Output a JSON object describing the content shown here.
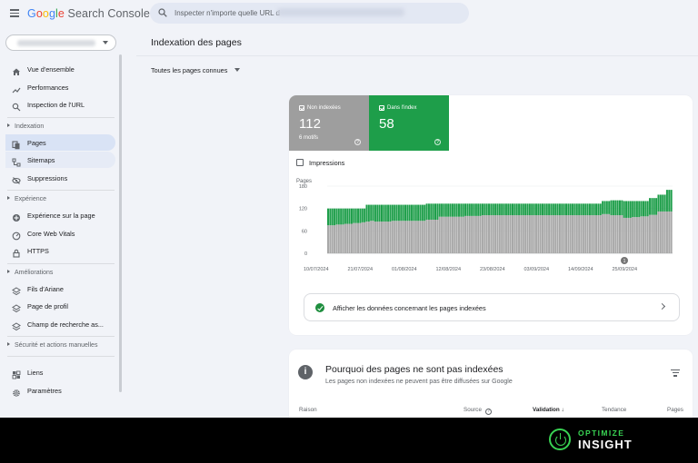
{
  "app": {
    "logo_google": [
      "G",
      "o",
      "o",
      "g",
      "l",
      "e"
    ],
    "logo_product": "Search Console"
  },
  "search": {
    "placeholder": "Inspecter n'importe quelle URL d"
  },
  "sidebar": {
    "items": [
      {
        "label": "Vue d'ensemble",
        "icon": "home-icon"
      },
      {
        "label": "Performances",
        "icon": "trending-up-icon"
      },
      {
        "label": "Inspection de l'URL",
        "icon": "search-icon"
      }
    ],
    "sections": [
      {
        "label": "Indexation",
        "items": [
          {
            "label": "Pages",
            "icon": "pages-icon",
            "active": true
          },
          {
            "label": "Sitemaps",
            "icon": "sitemap-icon"
          },
          {
            "label": "Suppressions",
            "icon": "eye-off-icon"
          }
        ]
      },
      {
        "label": "Expérience",
        "items": [
          {
            "label": "Expérience sur la page",
            "icon": "plus-circle-icon"
          },
          {
            "label": "Core Web Vitals",
            "icon": "gauge-icon"
          },
          {
            "label": "HTTPS",
            "icon": "lock-icon"
          }
        ]
      },
      {
        "label": "Améliorations",
        "items": [
          {
            "label": "Fils d'Ariane",
            "icon": "layers-icon"
          },
          {
            "label": "Page de profil",
            "icon": "layers-icon"
          },
          {
            "label": "Champ de recherche as...",
            "icon": "layers-icon"
          }
        ]
      },
      {
        "label": "Sécurité et actions manuelles",
        "items": []
      }
    ],
    "bottom_items": [
      {
        "label": "Liens",
        "icon": "links-icon"
      },
      {
        "label": "Paramètres",
        "icon": "gear-icon"
      }
    ]
  },
  "main": {
    "title": "Indexation des pages",
    "filter_label": "Toutes les pages connues",
    "tiles": {
      "not_indexed": {
        "label": "Non indexées",
        "value": "112",
        "sub": "6 motifs",
        "color": "#9e9e9e"
      },
      "indexed": {
        "label": "Dans l'index",
        "value": "58",
        "color": "#1e9e4a"
      }
    },
    "impressions_label": "Impressions",
    "show_indexed_label": "Afficher les données concernant les pages indexées",
    "why_card": {
      "title": "Pourquoi des pages ne sont pas indexées",
      "subtitle": "Les pages non indexées ne peuvent pas être diffusées sur Google",
      "columns": [
        "Raison",
        "Source",
        "Validation",
        "Tendance",
        "Pages"
      ]
    }
  },
  "chart_data": {
    "type": "bar",
    "stacked": true,
    "ylabel": "Pages",
    "ylim": [
      0,
      180
    ],
    "yticks": [
      0,
      60,
      120,
      180
    ],
    "xtick_labels": [
      "10/07/2024",
      "21/07/2024",
      "01/08/2024",
      "12/08/2024",
      "23/08/2024",
      "03/09/2024",
      "14/09/2024",
      "25/09/2024"
    ],
    "annotation": "1",
    "series": [
      {
        "name": "Non indexées",
        "color": "#a8a8a8",
        "values": [
          75,
          75,
          75,
          75,
          77,
          77,
          77,
          77,
          79,
          79,
          79,
          79,
          81,
          81,
          81,
          81,
          83,
          83,
          85,
          85,
          87,
          87,
          85,
          85,
          85,
          85,
          85,
          85,
          85,
          85,
          87,
          87,
          87,
          87,
          87,
          87,
          87,
          87,
          87,
          87,
          87,
          87,
          87,
          87,
          87,
          87,
          90,
          90,
          90,
          90,
          90,
          90,
          98,
          98,
          98,
          98,
          98,
          98,
          98,
          98,
          98,
          98,
          98,
          98,
          100,
          100,
          100,
          100,
          100,
          100,
          100,
          100,
          102,
          102,
          102,
          102,
          102,
          102,
          102,
          102,
          102,
          102,
          102,
          102,
          102,
          102,
          102,
          102,
          102,
          102,
          102,
          102,
          102,
          102,
          102,
          102,
          102,
          102,
          102,
          102,
          102,
          102,
          102,
          102,
          102,
          102,
          102,
          102,
          102,
          102,
          102,
          102,
          102,
          102,
          102,
          102,
          102,
          102,
          102,
          102,
          102,
          102,
          102,
          102,
          102,
          102,
          102,
          102,
          105,
          105,
          105,
          105,
          102,
          102,
          102,
          102,
          102,
          102,
          95,
          95,
          95,
          95,
          97,
          97,
          97,
          97,
          99,
          99,
          99,
          99,
          103,
          103,
          103,
          103,
          112,
          112,
          112,
          112,
          112,
          112,
          112
        ]
      },
      {
        "name": "Dans l'index",
        "color": "#1e9e4a",
        "values": [
          45,
          45,
          45,
          45,
          43,
          43,
          43,
          43,
          41,
          41,
          41,
          41,
          39,
          39,
          39,
          39,
          37,
          37,
          45,
          45,
          43,
          43,
          45,
          45,
          45,
          45,
          45,
          45,
          45,
          45,
          43,
          43,
          43,
          43,
          43,
          43,
          43,
          43,
          43,
          43,
          43,
          43,
          43,
          43,
          43,
          43,
          43,
          43,
          43,
          43,
          43,
          43,
          35,
          35,
          35,
          35,
          35,
          35,
          35,
          35,
          35,
          35,
          35,
          35,
          33,
          33,
          33,
          33,
          33,
          33,
          33,
          33,
          31,
          31,
          31,
          31,
          31,
          31,
          31,
          31,
          31,
          31,
          31,
          31,
          31,
          31,
          31,
          31,
          31,
          31,
          31,
          31,
          31,
          31,
          31,
          31,
          31,
          31,
          31,
          31,
          31,
          31,
          31,
          31,
          31,
          31,
          31,
          31,
          31,
          31,
          31,
          31,
          31,
          31,
          31,
          31,
          31,
          31,
          31,
          31,
          31,
          31,
          31,
          31,
          31,
          31,
          31,
          31,
          35,
          35,
          35,
          35,
          40,
          40,
          40,
          40,
          40,
          40,
          45,
          45,
          45,
          45,
          43,
          43,
          43,
          43,
          41,
          41,
          41,
          41,
          45,
          45,
          45,
          45,
          45,
          45,
          45,
          45,
          58,
          58,
          58
        ]
      }
    ]
  }
}
